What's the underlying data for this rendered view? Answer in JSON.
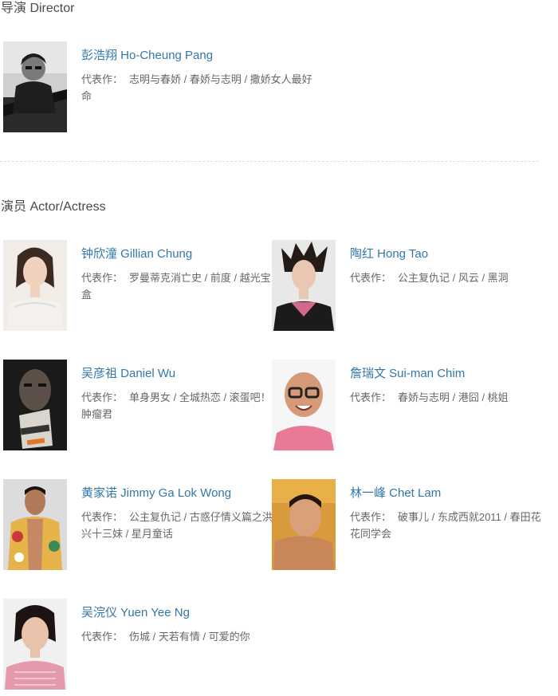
{
  "director_section": {
    "title": "导演 Director",
    "people": [
      {
        "name": "彭浩翔 Ho-Cheung Pang",
        "works_label": "代表作：",
        "works": "志明与春娇 / 春娇与志明 / 撒娇女人最好命"
      }
    ]
  },
  "actor_section": {
    "title": "演员 Actor/Actress",
    "people": [
      {
        "name": "钟欣潼 Gillian Chung",
        "works_label": "代表作：",
        "works": "罗曼蒂克消亡史 / 前度 / 越光宝盒"
      },
      {
        "name": "陶红 Hong Tao",
        "works_label": "代表作：",
        "works": "公主复仇记 / 风云 / 黑洞"
      },
      {
        "name": "吴彦祖 Daniel Wu",
        "works_label": "代表作：",
        "works": "单身男女 / 全城热恋 / 滚蛋吧！肿瘤君"
      },
      {
        "name": "詹瑞文 Sui-man Chim",
        "works_label": "代表作：",
        "works": "春娇与志明 / 港囧 / 桃姐"
      },
      {
        "name": "黄家诺 Jimmy Ga Lok Wong",
        "works_label": "代表作：",
        "works": "公主复仇记 / 古惑仔情义篇之洪兴十三妹 / 星月童话"
      },
      {
        "name": "林一峰 Chet Lam",
        "works_label": "代表作：",
        "works": "破事儿 / 东成西就2011 / 春田花花同学会"
      },
      {
        "name": "吴浣仪 Yuen Yee Ng",
        "works_label": "代表作：",
        "works": "伤城 / 天若有情 / 可爱的你"
      }
    ]
  }
}
